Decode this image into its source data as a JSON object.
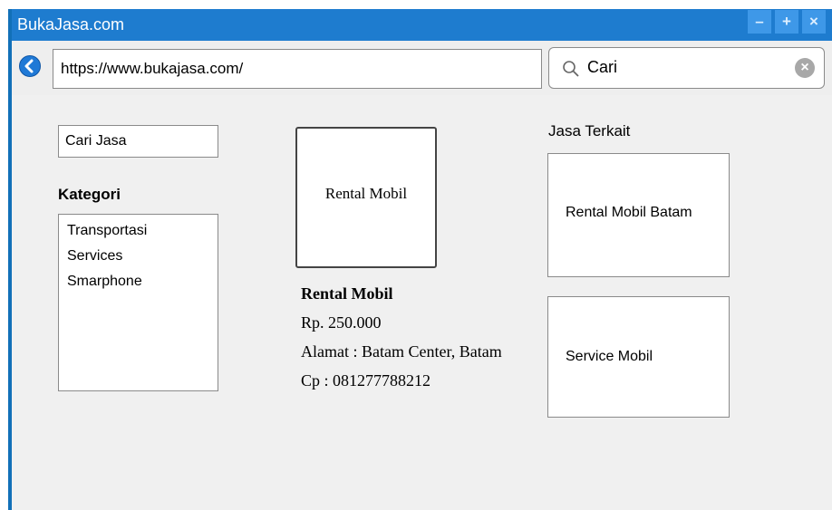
{
  "window": {
    "title": "BukaJasa.com"
  },
  "titlebar": {
    "buttons": [
      "–",
      "+",
      "×"
    ]
  },
  "address_bar": {
    "url": "https://www.bukajasa.com/"
  },
  "search": {
    "value": "Cari"
  },
  "sidebar": {
    "search_field": "Cari Jasa",
    "category_heading": "Kategori",
    "categories": [
      "Transportasi",
      "Services",
      "Smarphone"
    ]
  },
  "product": {
    "image_label": "Rental Mobil",
    "name": "Rental Mobil",
    "price": "Rp. 250.000",
    "address": "Alamat : Batam Center, Batam",
    "contact": "Cp : 081277788212"
  },
  "related": {
    "heading": "Jasa Terkait",
    "items": [
      "Rental Mobil Batam",
      "Service Mobil"
    ]
  }
}
